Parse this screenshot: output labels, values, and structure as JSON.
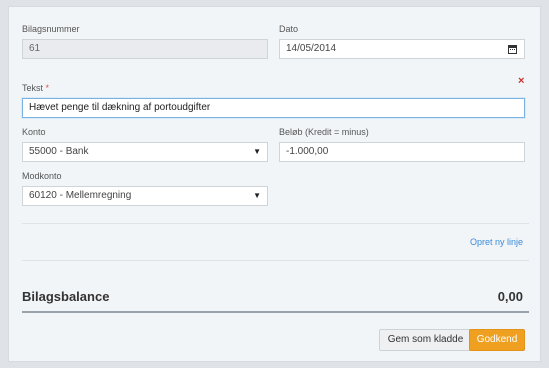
{
  "form": {
    "bilagsnummer": {
      "label": "Bilagsnummer",
      "value": "61"
    },
    "dato": {
      "label": "Dato",
      "value": "14/05/2014"
    },
    "tekst": {
      "label": "Tekst",
      "required_mark": "*",
      "value": "Hævet penge til dækning af portoudgifter"
    },
    "konto": {
      "label": "Konto",
      "value": "55000 - Bank"
    },
    "beloeb": {
      "label": "Beløb (Kredit = minus)",
      "value": "-1.000,00"
    },
    "modkonto": {
      "label": "Modkonto",
      "value": "60120 - Mellemregning"
    },
    "remove_line": "×"
  },
  "add_line_link": "Opret ny linje",
  "balance": {
    "label": "Bilagsbalance",
    "value": "0,00"
  },
  "buttons": {
    "save_draft": "Gem som kladde",
    "approve": "Godkend"
  },
  "colors": {
    "accent": "#f0a020",
    "link": "#3a8bd8",
    "required": "#d9534f"
  }
}
